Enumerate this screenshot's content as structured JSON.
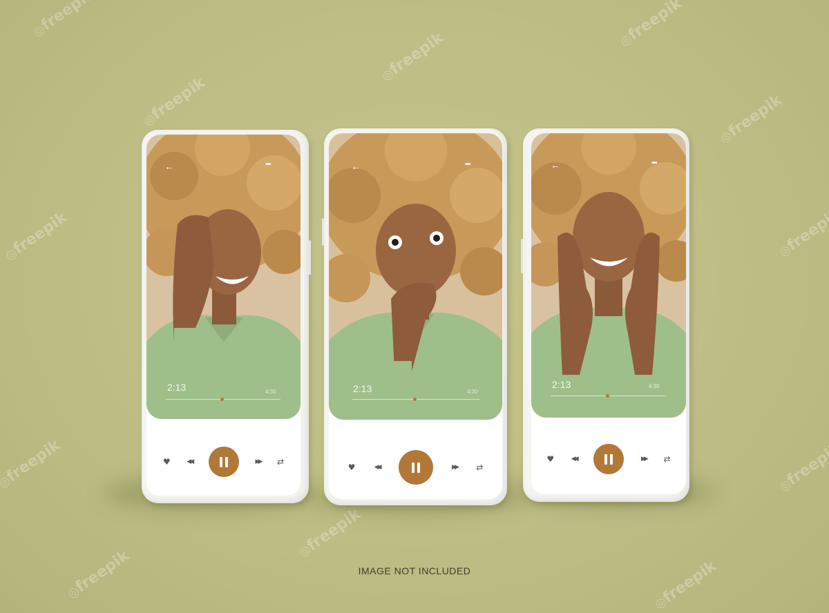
{
  "watermark": "freepik",
  "caption": "IMAGE NOT INCLUDED",
  "colors": {
    "background": "#bdbd85",
    "accent": "#b27838",
    "shirt": "#9fbf8a",
    "hair": "#c89a5a"
  },
  "player": {
    "back_icon": "arrow-left-icon",
    "more_icon": "more-dots-icon",
    "current_time": "2:13",
    "duration": "4:30",
    "progress": 0.49,
    "controls": [
      "heart-icon",
      "rewind-icon",
      "pause-icon",
      "fast-forward-icon",
      "repeat-icon"
    ]
  },
  "glyphs": {
    "back": "←",
    "more": "•••",
    "heart": "♥",
    "rewind": "◀◀",
    "forward": "▶▶",
    "repeat": "⇄"
  },
  "phones": [
    {
      "id": "left",
      "expression": "laughing"
    },
    {
      "id": "center",
      "expression": "surprised"
    },
    {
      "id": "right",
      "expression": "smiling"
    }
  ]
}
